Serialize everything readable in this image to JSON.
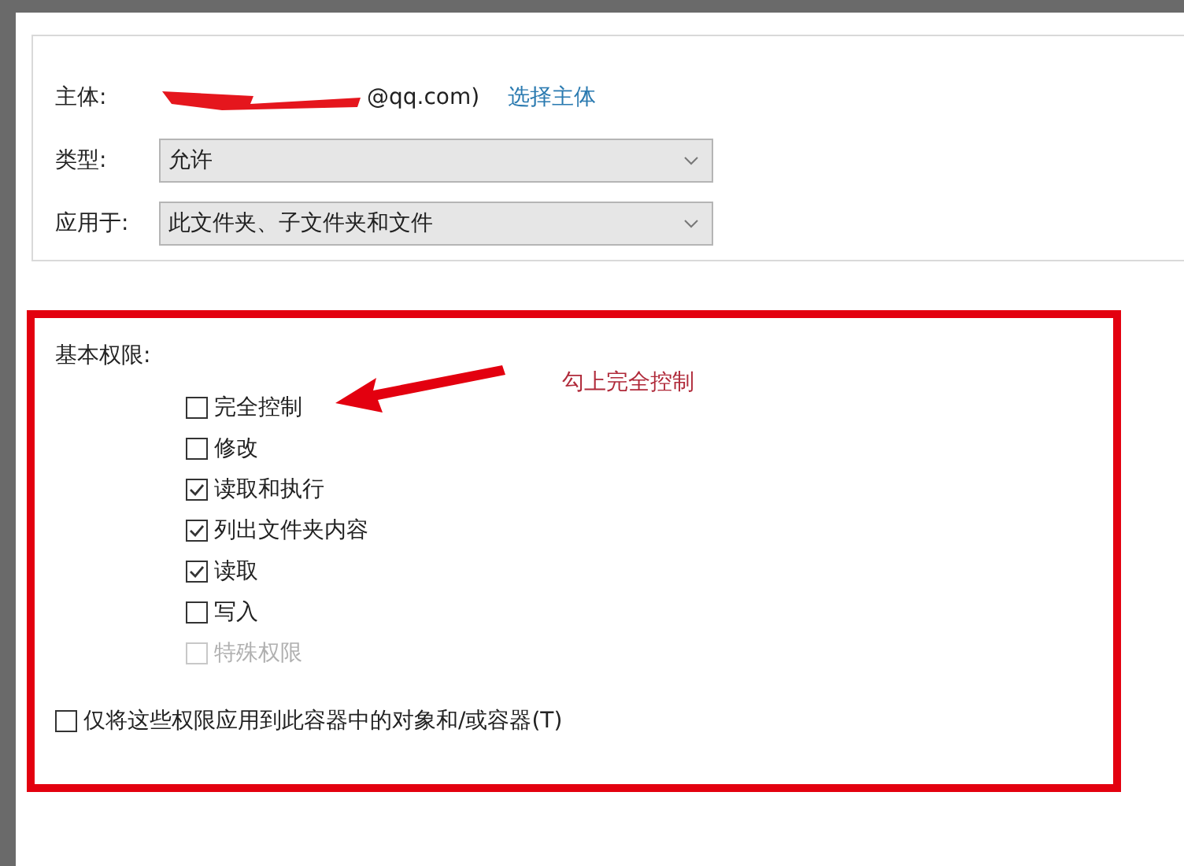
{
  "principal": {
    "label": "主体:",
    "value": "@qq.com)",
    "link": "选择主体"
  },
  "type": {
    "label": "类型:",
    "value": "允许"
  },
  "applies_to": {
    "label": "应用于:",
    "value": "此文件夹、子文件夹和文件"
  },
  "permissions": {
    "title": "基本权限:",
    "items": [
      {
        "label": "完全控制",
        "checked": false,
        "disabled": false
      },
      {
        "label": "修改",
        "checked": false,
        "disabled": false
      },
      {
        "label": "读取和执行",
        "checked": true,
        "disabled": false
      },
      {
        "label": "列出文件夹内容",
        "checked": true,
        "disabled": false
      },
      {
        "label": "读取",
        "checked": true,
        "disabled": false
      },
      {
        "label": "写入",
        "checked": false,
        "disabled": false
      },
      {
        "label": "特殊权限",
        "checked": false,
        "disabled": true
      }
    ]
  },
  "apply_only": {
    "label": "仅将这些权限应用到此容器中的对象和/或容器(T)",
    "checked": false
  },
  "annotation": {
    "text": "勾上完全控制"
  }
}
